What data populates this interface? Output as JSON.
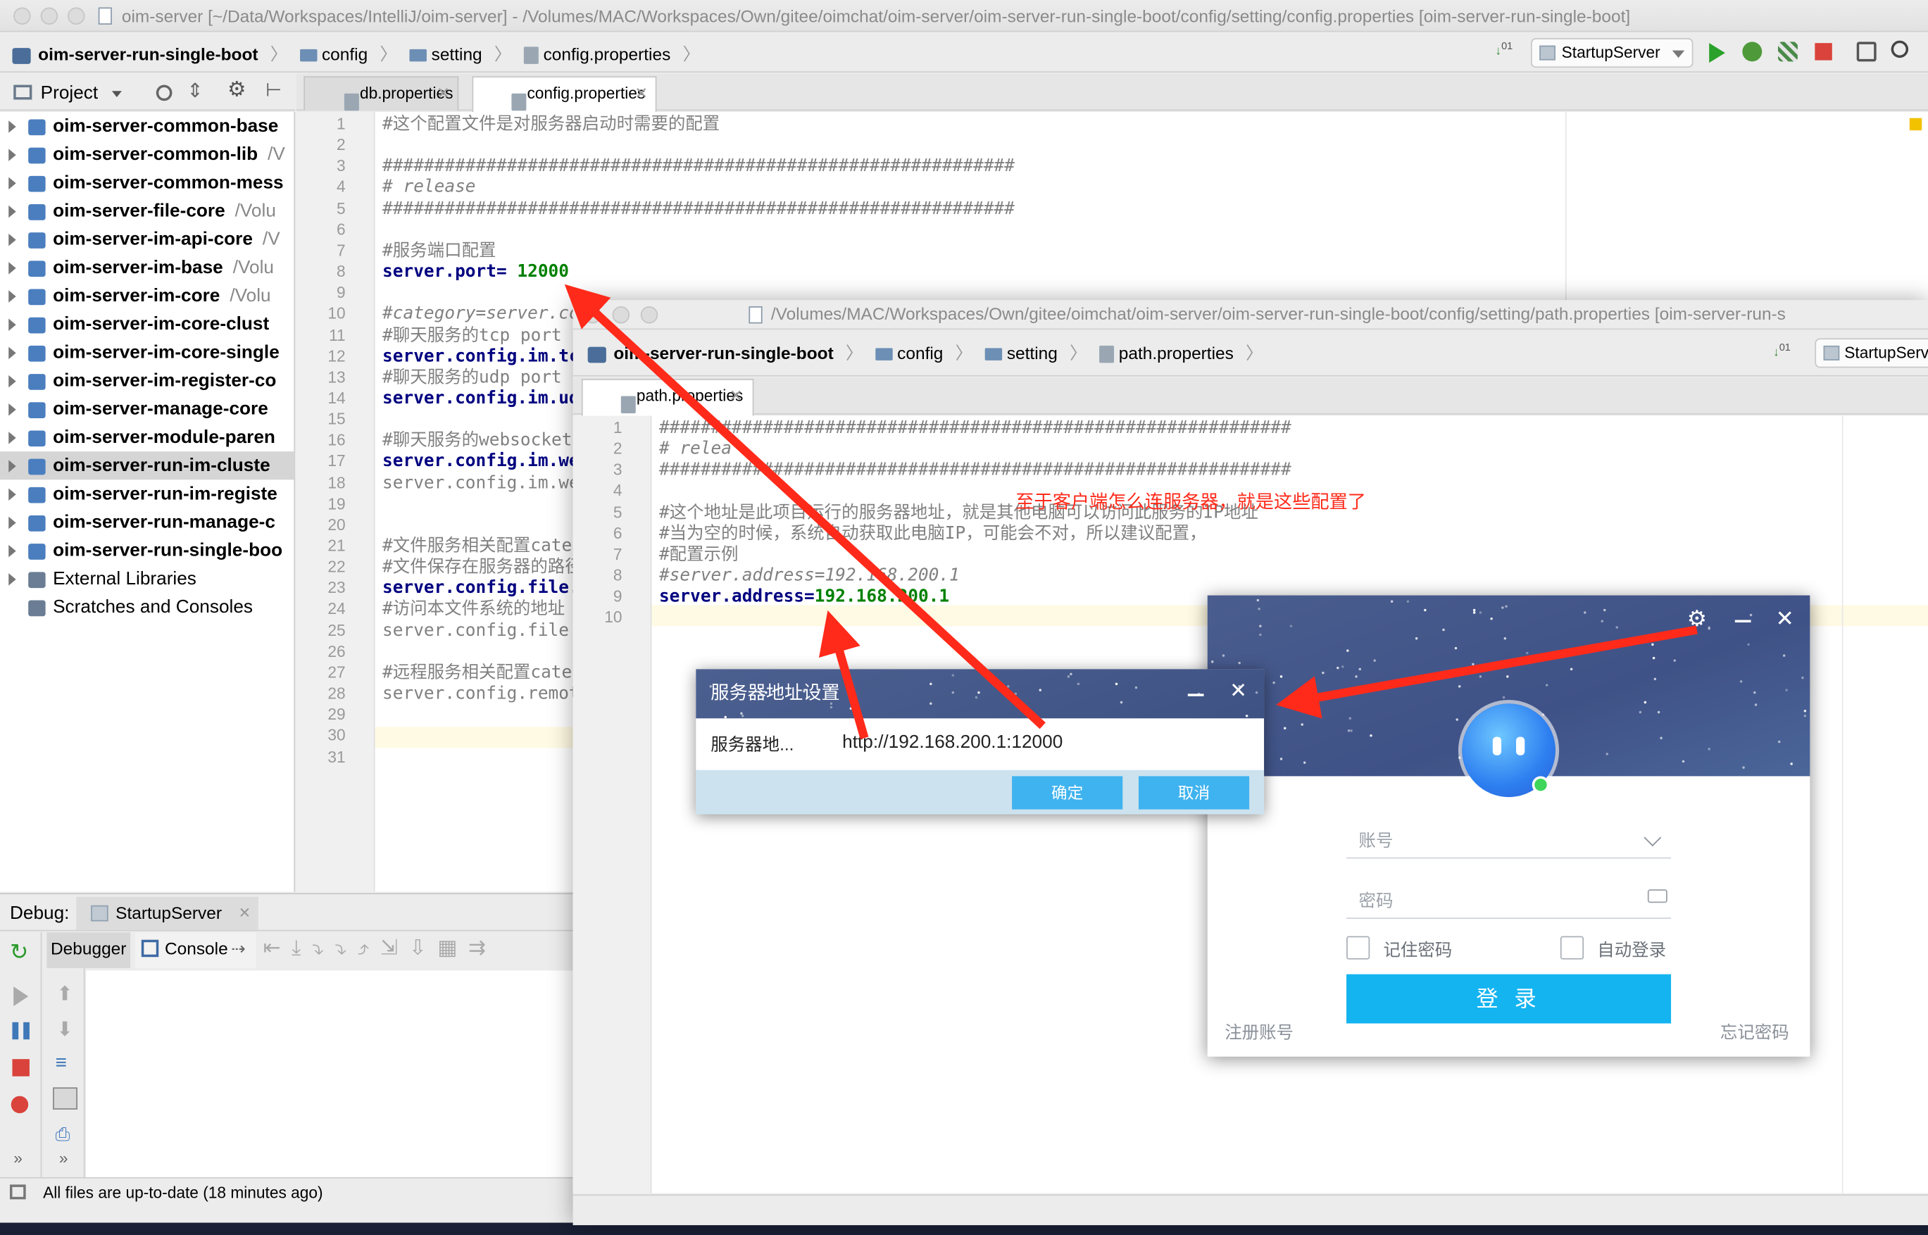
{
  "main_window": {
    "title": "oim-server [~/Data/Workspaces/IntelliJ/oim-server] - /Volumes/MAC/Workspaces/Own/gitee/oimchat/oim-server/oim-server-run-single-boot/config/setting/config.properties [oim-server-run-single-boot]",
    "breadcrumbs": [
      "oim-server-run-single-boot",
      "config",
      "setting",
      "config.properties"
    ],
    "run_config": "StartupServer",
    "project_label": "Project",
    "tabs": [
      "db.properties",
      "config.properties"
    ],
    "tree": [
      {
        "name": "oim-server-common-base",
        "suffix": "",
        "bold": true
      },
      {
        "name": "oim-server-common-lib",
        "suffix": "/V",
        "bold": true
      },
      {
        "name": "oim-server-common-mess",
        "suffix": "",
        "bold": true
      },
      {
        "name": "oim-server-file-core",
        "suffix": "/Volu",
        "bold": true
      },
      {
        "name": "oim-server-im-api-core",
        "suffix": "/V",
        "bold": true
      },
      {
        "name": "oim-server-im-base",
        "suffix": "/Volu",
        "bold": true
      },
      {
        "name": "oim-server-im-core",
        "suffix": "/Volu",
        "bold": true
      },
      {
        "name": "oim-server-im-core-clust",
        "suffix": "",
        "bold": true
      },
      {
        "name": "oim-server-im-core-single",
        "suffix": "",
        "bold": true
      },
      {
        "name": "oim-server-im-register-co",
        "suffix": "",
        "bold": true
      },
      {
        "name": "oim-server-manage-core",
        "suffix": "",
        "bold": true
      },
      {
        "name": "oim-server-module-paren",
        "suffix": "",
        "bold": true
      },
      {
        "name": "oim-server-run-im-cluste",
        "suffix": "",
        "bold": true
      },
      {
        "name": "oim-server-run-im-registe",
        "suffix": "",
        "bold": true
      },
      {
        "name": "oim-server-run-manage-c",
        "suffix": "",
        "bold": true
      },
      {
        "name": "oim-server-run-single-boo",
        "suffix": "",
        "bold": true
      },
      {
        "name": "External Libraries",
        "suffix": "",
        "bold": false
      },
      {
        "name": "Scratches and Consoles",
        "suffix": "",
        "bold": false
      }
    ],
    "code_lines": [
      {
        "n": "1",
        "parts": [
          {
            "t": "#这个配置文件是对服务器启动时需要的配置",
            "c": "comment"
          }
        ]
      },
      {
        "n": "2",
        "parts": []
      },
      {
        "n": "3",
        "parts": [
          {
            "t": "#############################################################",
            "c": "comment"
          }
        ]
      },
      {
        "n": "4",
        "parts": [
          {
            "t": "# release",
            "c": "comment italic"
          }
        ]
      },
      {
        "n": "5",
        "parts": [
          {
            "t": "#############################################################",
            "c": "comment"
          }
        ]
      },
      {
        "n": "6",
        "parts": []
      },
      {
        "n": "7",
        "parts": [
          {
            "t": "#服务端口配置",
            "c": "comment"
          }
        ]
      },
      {
        "n": "8",
        "parts": [
          {
            "t": "server.port",
            "c": "key"
          },
          {
            "t": "= ",
            "c": "key"
          },
          {
            "t": "12000",
            "c": "val"
          }
        ]
      },
      {
        "n": "9",
        "parts": []
      },
      {
        "n": "10",
        "parts": [
          {
            "t": "#category=server.cor",
            "c": "comment italic"
          }
        ]
      },
      {
        "n": "11",
        "parts": [
          {
            "t": "#聊天服务的tcp port",
            "c": "comment"
          }
        ]
      },
      {
        "n": "12",
        "parts": [
          {
            "t": "server.config.im.tcp",
            "c": "key"
          }
        ]
      },
      {
        "n": "13",
        "parts": [
          {
            "t": "#聊天服务的udp port",
            "c": "comment"
          }
        ]
      },
      {
        "n": "14",
        "parts": [
          {
            "t": "server.config.im.udp",
            "c": "key"
          }
        ]
      },
      {
        "n": "15",
        "parts": []
      },
      {
        "n": "16",
        "parts": [
          {
            "t": "#聊天服务的websocket",
            "c": "comment"
          }
        ]
      },
      {
        "n": "17",
        "parts": [
          {
            "t": "server.config.im.web",
            "c": "key"
          }
        ]
      },
      {
        "n": "18",
        "parts": [
          {
            "t": "server.config.im.web",
            "c": "comment"
          }
        ]
      },
      {
        "n": "19",
        "parts": []
      },
      {
        "n": "20",
        "parts": []
      },
      {
        "n": "21",
        "parts": [
          {
            "t": "#文件服务相关配置categ",
            "c": "comment"
          }
        ]
      },
      {
        "n": "22",
        "parts": [
          {
            "t": "#文件保存在服务器的路径",
            "c": "comment"
          }
        ]
      },
      {
        "n": "23",
        "parts": [
          {
            "t": "server.config.file.u",
            "c": "key"
          }
        ]
      },
      {
        "n": "24",
        "parts": [
          {
            "t": "#访问本文件系统的地址",
            "c": "comment"
          }
        ]
      },
      {
        "n": "25",
        "parts": [
          {
            "t": "server.config.file.",
            "c": "comment"
          }
        ]
      },
      {
        "n": "26",
        "parts": []
      },
      {
        "n": "27",
        "parts": [
          {
            "t": "#远程服务相关配置categ",
            "c": "comment"
          }
        ]
      },
      {
        "n": "28",
        "parts": [
          {
            "t": "server.config.remote",
            "c": "comment"
          }
        ]
      },
      {
        "n": "29",
        "parts": []
      },
      {
        "n": "30",
        "parts": []
      },
      {
        "n": "31",
        "parts": []
      }
    ],
    "debug": {
      "label": "Debug:",
      "config": "StartupServer",
      "tabs": [
        "Debugger",
        "Console"
      ]
    },
    "status": "All files are up-to-date (18 minutes ago)"
  },
  "second_window": {
    "title": "/Volumes/MAC/Workspaces/Own/gitee/oimchat/oim-server/oim-server-run-single-boot/config/setting/path.properties [oim-server-run-s",
    "breadcrumbs": [
      "oim-server-run-single-boot",
      "config",
      "setting",
      "path.properties"
    ],
    "run_config": "StartupServ",
    "tab": "path.properties",
    "code_lines": [
      {
        "n": "1",
        "parts": [
          {
            "t": "#############################################################",
            "c": "comment"
          }
        ]
      },
      {
        "n": "2",
        "parts": [
          {
            "t": "# relea",
            "c": "comment italic"
          }
        ]
      },
      {
        "n": "3",
        "parts": [
          {
            "t": "#############################################################",
            "c": "comment"
          }
        ]
      },
      {
        "n": "4",
        "parts": []
      },
      {
        "n": "5",
        "parts": [
          {
            "t": "#这个地址是此项目运行的服务器地址，就是其他电脑可以访问此服务的IP地址",
            "c": "comment"
          }
        ]
      },
      {
        "n": "6",
        "parts": [
          {
            "t": "#当为空的时候，系统自动获取此电脑IP，可能会不对，所以建议配置，",
            "c": "comment"
          }
        ]
      },
      {
        "n": "7",
        "parts": [
          {
            "t": "#配置示例",
            "c": "comment"
          }
        ]
      },
      {
        "n": "8",
        "parts": [
          {
            "t": "#server.address=192.168.200.1",
            "c": "comment italic"
          }
        ]
      },
      {
        "n": "9",
        "parts": [
          {
            "t": "server.address",
            "c": "key"
          },
          {
            "t": "=",
            "c": "key"
          },
          {
            "t": "192.168.200.1",
            "c": "val"
          }
        ]
      },
      {
        "n": "10",
        "parts": []
      }
    ],
    "annotation": "至于客户端怎么连服务器，就是这些配置了"
  },
  "server_dialog": {
    "title": "服务器地址设置",
    "field_label": "服务器地...",
    "field_value": "http://192.168.200.1:12000",
    "ok": "确定",
    "cancel": "取消"
  },
  "login_window": {
    "account_placeholder": "账号",
    "password_placeholder": "密码",
    "remember": "记住密码",
    "auto_login": "自动登录",
    "login": "登 录",
    "register": "注册账号",
    "forgot": "忘记密码"
  },
  "colors": {
    "annotation_red": "#ff2a1a",
    "login_blue": "#14b4f0",
    "dialog_button_blue": "#3fb3ef"
  }
}
